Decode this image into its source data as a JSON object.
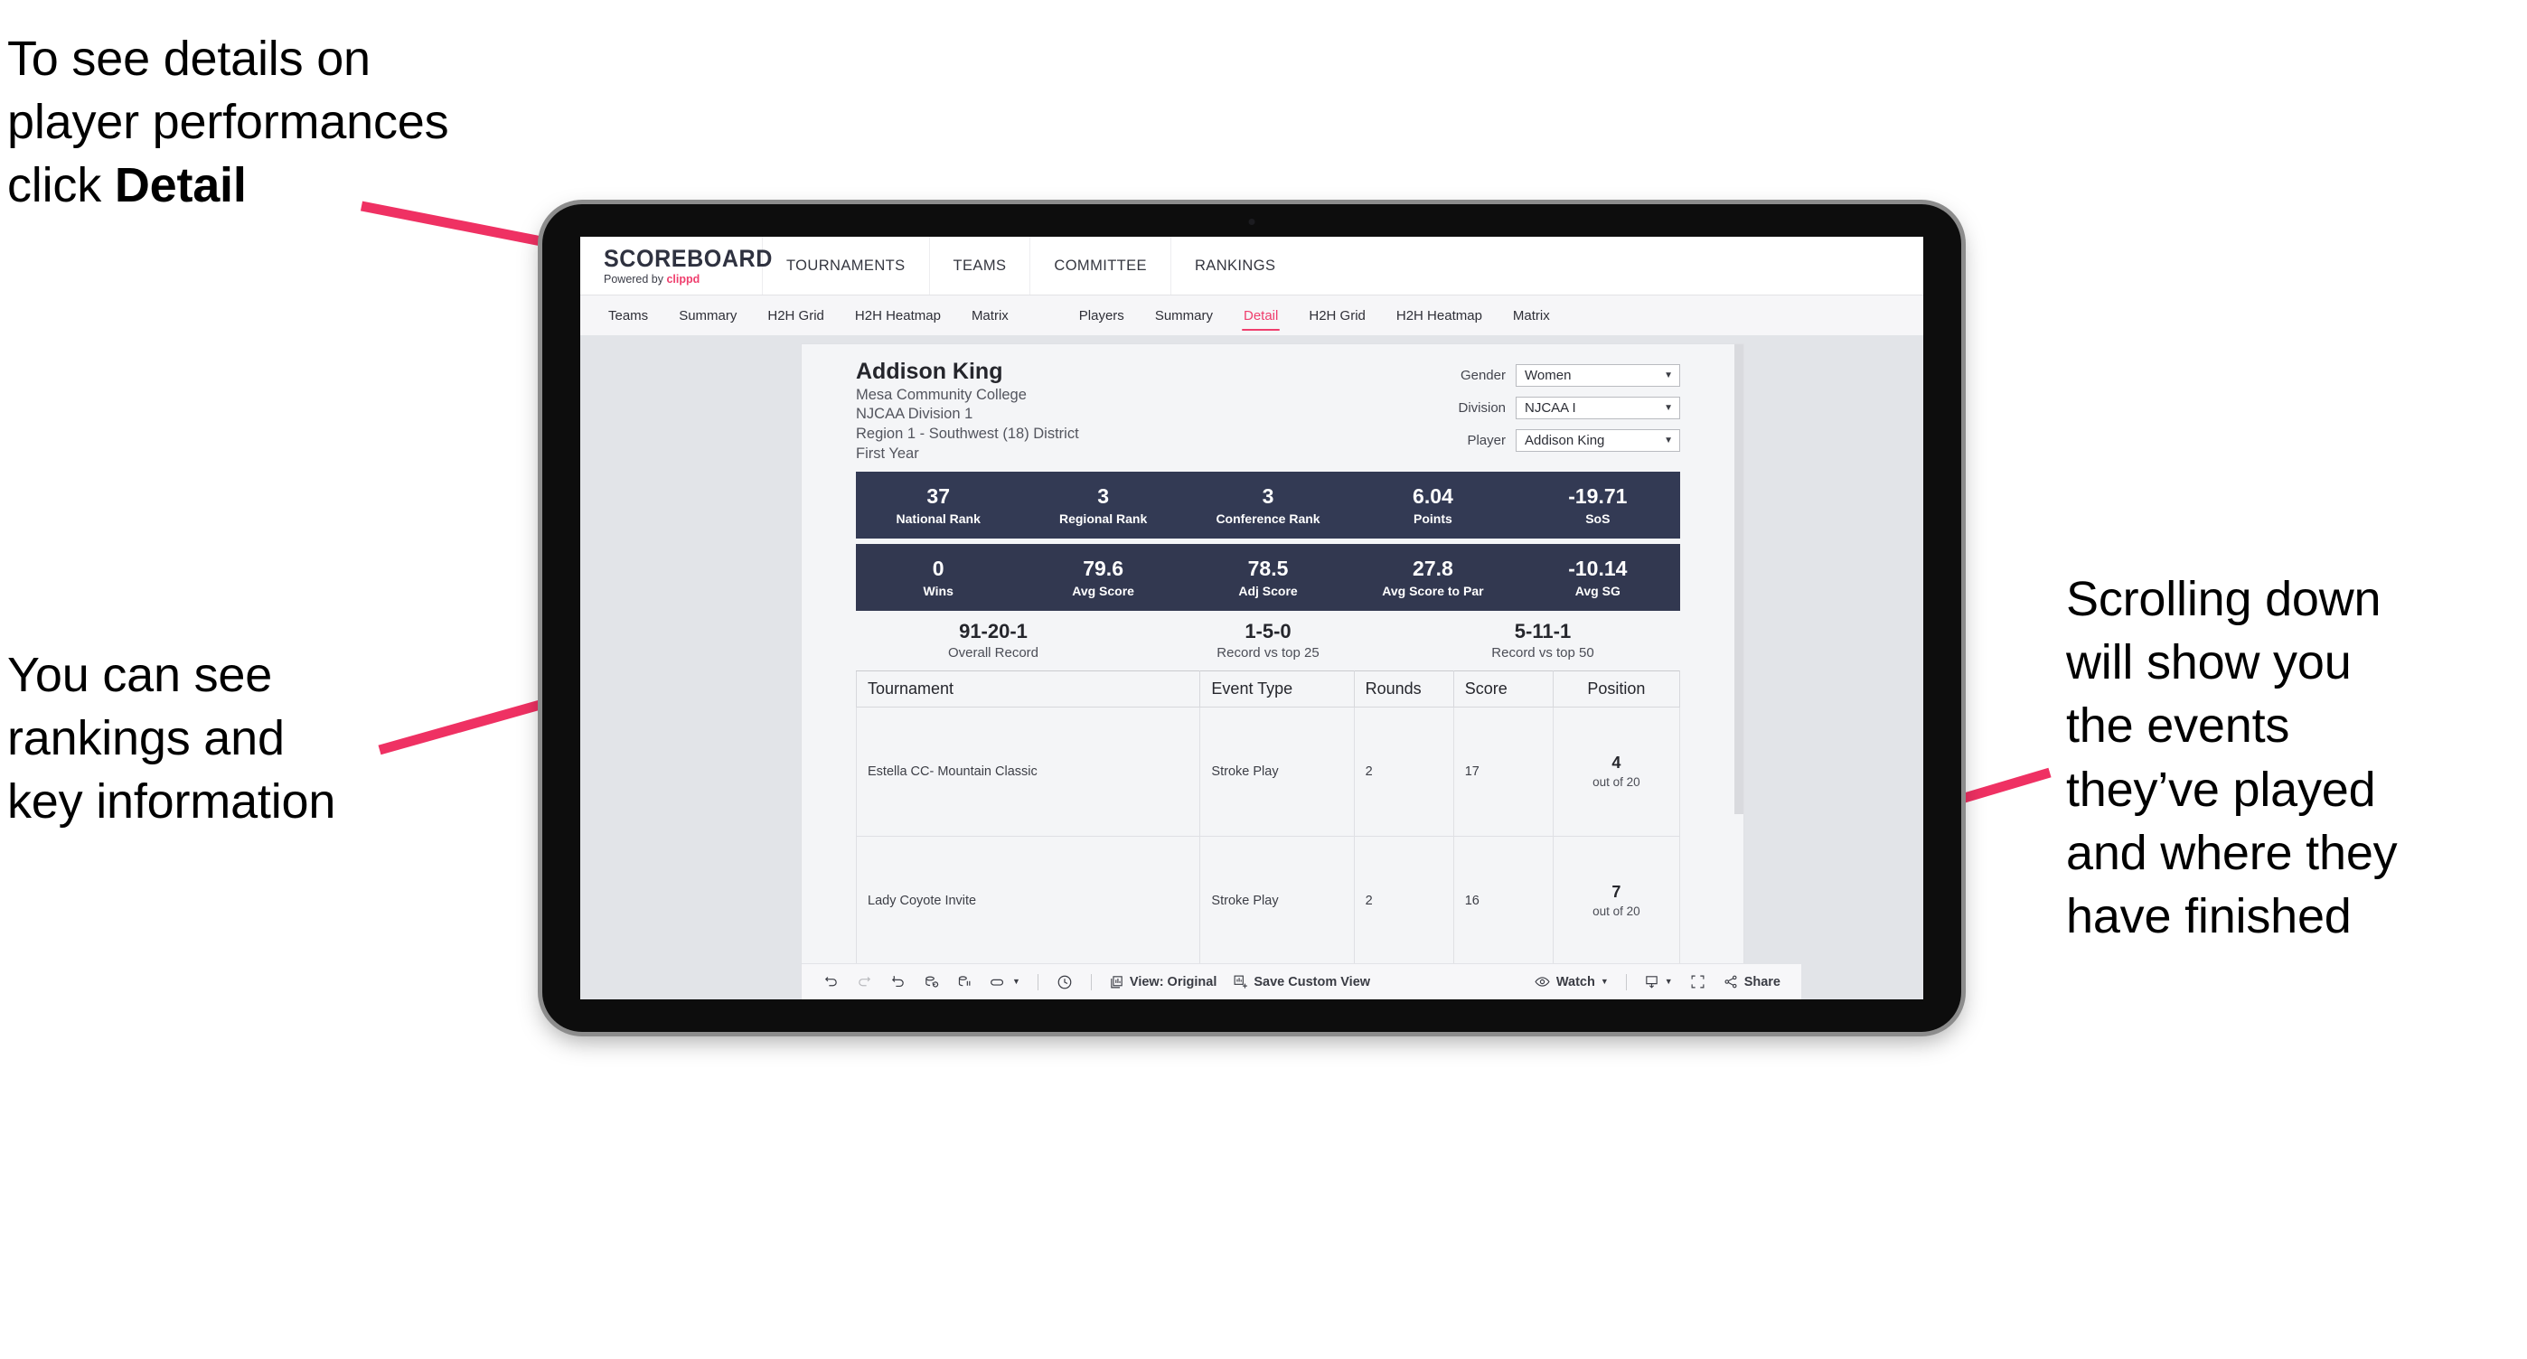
{
  "annotations": {
    "detail": {
      "line1": "To see details on",
      "line2": "player performances",
      "line3_prefix": "click ",
      "line3_bold": "Detail"
    },
    "rankings": {
      "line1": "You can see",
      "line2": "rankings and",
      "line3": "key information"
    },
    "scroll": {
      "line1": "Scrolling down",
      "line2": "will show you",
      "line3": "the events",
      "line4": "they’ve played",
      "line5": "and where they",
      "line6": "have finished"
    },
    "accent_color": "#ef3163"
  },
  "app": {
    "brand": {
      "title": "SCOREBOARD",
      "powered_prefix": "Powered by ",
      "powered_accent": "clippd"
    },
    "topnav": [
      {
        "label": "TOURNAMENTS"
      },
      {
        "label": "TEAMS"
      },
      {
        "label": "COMMITTEE"
      },
      {
        "label": "RANKINGS"
      }
    ],
    "subnav_teams": [
      {
        "label": "Teams"
      },
      {
        "label": "Summary"
      },
      {
        "label": "H2H Grid"
      },
      {
        "label": "H2H Heatmap"
      },
      {
        "label": "Matrix"
      }
    ],
    "subnav_players": [
      {
        "label": "Players",
        "active": false
      },
      {
        "label": "Summary",
        "active": false
      },
      {
        "label": "Detail",
        "active": true
      },
      {
        "label": "H2H Grid",
        "active": false
      },
      {
        "label": "H2H Heatmap",
        "active": false
      },
      {
        "label": "Matrix",
        "active": false
      }
    ],
    "active_tab_color": "#ef3e6d"
  },
  "player": {
    "name": "Addison King",
    "school": "Mesa Community College",
    "division": "NJCAA Division 1",
    "region": "Region 1 - Southwest (18) District",
    "year": "First Year"
  },
  "filters": [
    {
      "label": "Gender",
      "value": "Women"
    },
    {
      "label": "Division",
      "value": "NJCAA I"
    },
    {
      "label": "Player",
      "value": "Addison King"
    }
  ],
  "stats_row_1": [
    {
      "value": "37",
      "label": "National Rank"
    },
    {
      "value": "3",
      "label": "Regional Rank"
    },
    {
      "value": "3",
      "label": "Conference Rank"
    },
    {
      "value": "6.04",
      "label": "Points"
    },
    {
      "value": "-19.71",
      "label": "SoS"
    }
  ],
  "stats_row_2": [
    {
      "value": "0",
      "label": "Wins"
    },
    {
      "value": "79.6",
      "label": "Avg Score"
    },
    {
      "value": "78.5",
      "label": "Adj Score"
    },
    {
      "value": "27.8",
      "label": "Avg Score to Par"
    },
    {
      "value": "-10.14",
      "label": "Avg SG"
    }
  ],
  "records": [
    {
      "value": "91-20-1",
      "label": "Overall Record"
    },
    {
      "value": "1-5-0",
      "label": "Record vs top 25"
    },
    {
      "value": "5-11-1",
      "label": "Record vs top 50"
    }
  ],
  "table": {
    "columns": [
      "Tournament",
      "Event Type",
      "Rounds",
      "Score",
      "Position"
    ],
    "rows": [
      {
        "tournament": "Estella CC- Mountain Classic",
        "event_type": "Stroke Play",
        "rounds": "2",
        "score": "17",
        "position": "4",
        "position_sub": "out of 20"
      },
      {
        "tournament": "Lady Coyote Invite",
        "event_type": "Stroke Play",
        "rounds": "2",
        "score": "16",
        "position": "7",
        "position_sub": "out of 20"
      }
    ]
  },
  "toolbar": {
    "view_label": "View: Original",
    "save_label": "Save Custom View",
    "watch_label": "Watch",
    "share_label": "Share"
  },
  "statbar_color": "#333a54"
}
